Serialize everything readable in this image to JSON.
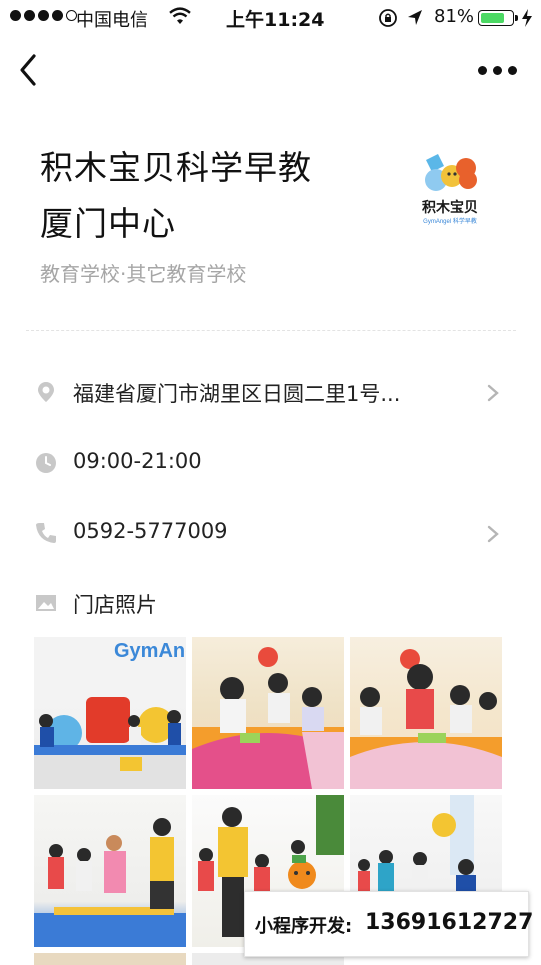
{
  "status_bar": {
    "carrier": "中国电信",
    "time": "上午11:24",
    "battery_percent": "81%",
    "battery_level": 0.81
  },
  "nav": {
    "back_icon": "chevron-left-icon",
    "more_icon": "more-dots-icon"
  },
  "store": {
    "name_line1": "积木宝贝科学早教",
    "name_line2": "厦门中心",
    "category": "教育学校·其它教育学校",
    "logo_text": "积木宝贝",
    "logo_subtext": "GymAngel 科学早教"
  },
  "info": {
    "address": "福建省厦门市湖里区日圆二里1号...",
    "hours": "09:00-21:00",
    "phone": "0592-5777009",
    "photos_label": "门店照片"
  },
  "photos": {
    "brand_text": "GymAng"
  },
  "watermark": {
    "label": "小程序开发:",
    "number": "13691612727"
  },
  "colors": {
    "icon_gray": "#c8c8c8",
    "subtitle_gray": "#a6a6a6",
    "battery_green": "#4cd964"
  }
}
